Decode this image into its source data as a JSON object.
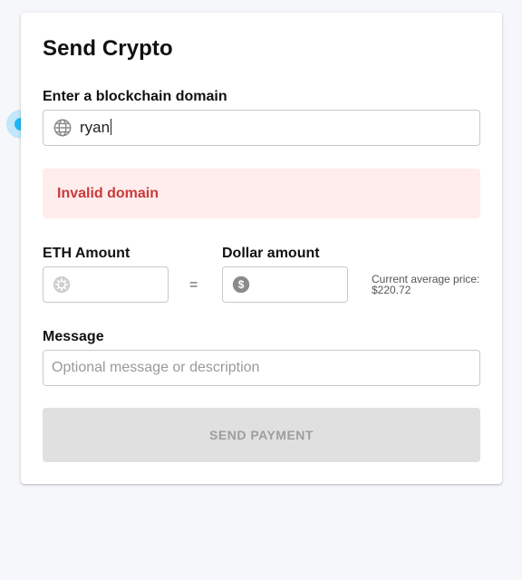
{
  "form": {
    "title": "Send Crypto",
    "domain": {
      "label": "Enter a blockchain domain",
      "value": "ryan",
      "icon": "globe-icon"
    },
    "error": {
      "text": "Invalid domain"
    },
    "eth": {
      "label": "ETH Amount",
      "value": "",
      "icon": "ethereum-icon"
    },
    "equals": "=",
    "usd": {
      "label": "Dollar amount",
      "value": "",
      "icon": "dollar-icon"
    },
    "price_note": {
      "label": "Current average price:",
      "value": "$220.72"
    },
    "message": {
      "label": "Message",
      "placeholder": "Optional message or description"
    },
    "send_button": "SEND PAYMENT"
  },
  "colors": {
    "error_bg": "#ffeced",
    "error_text": "#c93a38",
    "button_disabled_bg": "#e0e0e0",
    "button_disabled_text": "#9e9e9e",
    "touch_indicator": "#1fb6f3"
  }
}
